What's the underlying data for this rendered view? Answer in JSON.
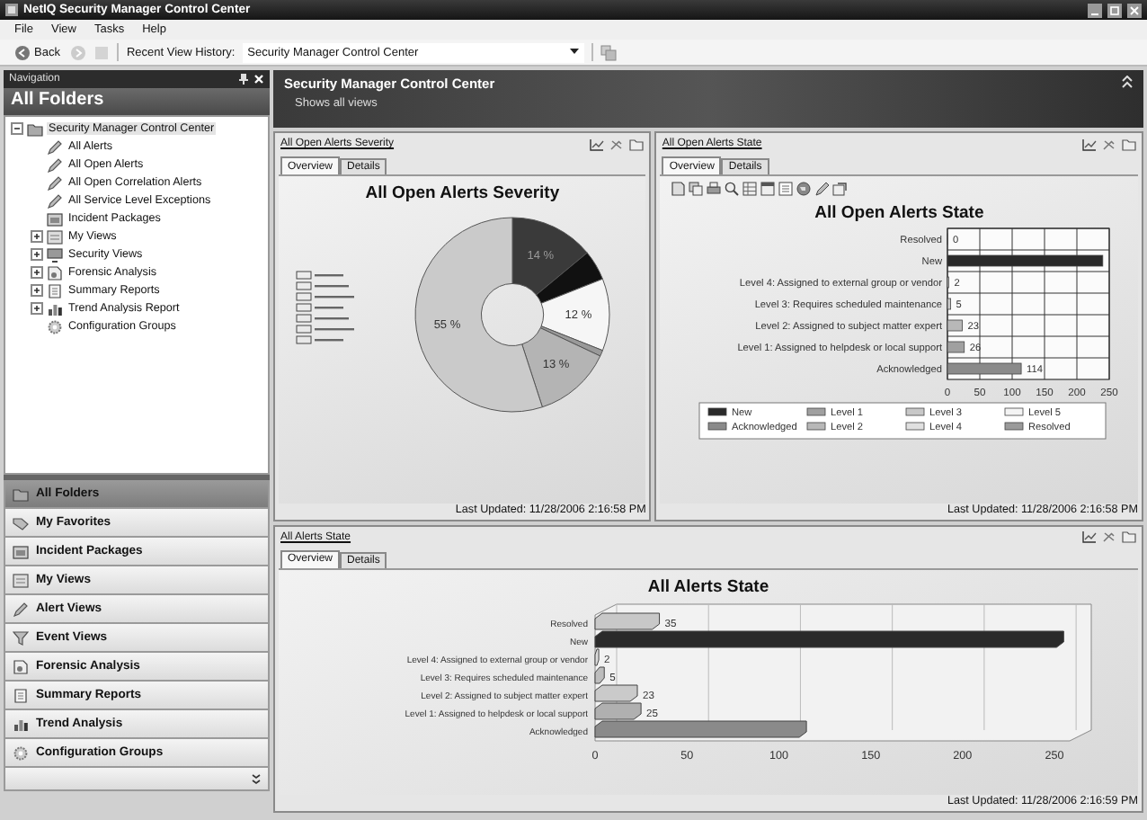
{
  "window": {
    "title": "NetIQ Security Manager Control Center"
  },
  "menu": [
    "File",
    "View",
    "Tasks",
    "Help"
  ],
  "toolbar": {
    "back": "Back",
    "history_label": "Recent View History:",
    "history_value": "Security Manager Control Center"
  },
  "navigation": {
    "title": "Navigation",
    "heading": "All Folders",
    "tree": [
      {
        "label": "Security Manager Control Center",
        "kind": "folder",
        "selected": true,
        "expanded": true,
        "children": [
          {
            "label": "All Alerts",
            "kind": "alert",
            "selected": false
          },
          {
            "label": "All Open Alerts",
            "kind": "alert",
            "selected": false
          },
          {
            "label": "All Open Correlation Alerts",
            "kind": "alert",
            "selected": false
          },
          {
            "label": "All Service Level Exceptions",
            "kind": "alert",
            "selected": false
          },
          {
            "label": "Incident Packages",
            "kind": "package",
            "selected": false
          },
          {
            "label": "My Views",
            "kind": "views",
            "selected": false,
            "expanded": false
          },
          {
            "label": "Security Views",
            "kind": "security",
            "selected": false,
            "expanded": false
          },
          {
            "label": "Forensic Analysis",
            "kind": "forensic",
            "selected": false,
            "expanded": false
          },
          {
            "label": "Summary Reports",
            "kind": "report",
            "selected": false,
            "expanded": false
          },
          {
            "label": "Trend Analysis Report",
            "kind": "trend",
            "selected": false,
            "expanded": false
          },
          {
            "label": "Configuration Groups",
            "kind": "config",
            "selected": false
          }
        ]
      }
    ],
    "buttons": [
      {
        "label": "All Folders",
        "kind": "folder",
        "selected": true
      },
      {
        "label": "My Favorites",
        "kind": "favorites",
        "selected": false
      },
      {
        "label": "Incident Packages",
        "kind": "package",
        "selected": false
      },
      {
        "label": "My Views",
        "kind": "views",
        "selected": false
      },
      {
        "label": "Alert Views",
        "kind": "alert",
        "selected": false
      },
      {
        "label": "Event Views",
        "kind": "event",
        "selected": false
      },
      {
        "label": "Forensic Analysis",
        "kind": "forensic",
        "selected": false
      },
      {
        "label": "Summary Reports",
        "kind": "report",
        "selected": false
      },
      {
        "label": "Trend Analysis",
        "kind": "trend",
        "selected": false
      },
      {
        "label": "Configuration Groups",
        "kind": "config",
        "selected": false
      }
    ]
  },
  "header": {
    "title": "Security Manager Control Center",
    "subtitle": "Shows all views"
  },
  "panels": [
    {
      "link": "All Open Alerts Severity",
      "tabs": [
        {
          "label": "Overview",
          "selected": true
        },
        {
          "label": "Details",
          "selected": false
        }
      ],
      "updated": "Last Updated: 11/28/2006 2:16:58 PM",
      "chart_data": {
        "type": "donut",
        "title": "All Open Alerts Severity",
        "values": [
          14,
          5,
          12,
          1,
          13,
          55
        ],
        "value_labels": [
          "14 %",
          null,
          "12 %",
          null,
          "13 %",
          "55 %"
        ]
      }
    },
    {
      "kind": "flat",
      "link": "All Open Alerts State",
      "tabs": [
        {
          "label": "Overview",
          "selected": true
        },
        {
          "label": "Details",
          "selected": false
        }
      ],
      "updated": "Last Updated: 11/28/2006 2:16:58 PM",
      "chart_data": {
        "type": "bar",
        "orientation": "horizontal",
        "title": "All Open Alerts State",
        "grid": true,
        "legend": "bottom",
        "categories": [
          "Resolved",
          "New",
          "Level 4: Assigned to external group or vendor",
          "Level 3: Requires scheduled maintenance",
          "Level 2: Assigned to subject matter expert",
          "Level 1: Assigned to helpdesk or local support",
          "Acknowledged"
        ],
        "series": [
          {
            "name": "New",
            "color": "#2a2a2a",
            "values": [
              null,
              240,
              null,
              null,
              null,
              null,
              null
            ]
          },
          {
            "name": "Level 1",
            "color": "#a0a0a0",
            "values": [
              null,
              null,
              null,
              null,
              null,
              26,
              null
            ]
          },
          {
            "name": "Level 3",
            "color": "#c8c8c8",
            "values": [
              null,
              null,
              null,
              5,
              null,
              null,
              null
            ]
          },
          {
            "name": "Level 5",
            "color": "#f4f4f4",
            "values": [
              null,
              null,
              null,
              null,
              null,
              null,
              null
            ]
          },
          {
            "name": "Acknowledged",
            "color": "#8a8a8a",
            "values": [
              null,
              null,
              null,
              null,
              null,
              null,
              114
            ]
          },
          {
            "name": "Level 2",
            "color": "#b8b8b8",
            "values": [
              null,
              null,
              null,
              null,
              23,
              null,
              null
            ]
          },
          {
            "name": "Level 4",
            "color": "#e0e0e0",
            "values": [
              null,
              null,
              2,
              null,
              null,
              null,
              null
            ]
          },
          {
            "name": "Resolved",
            "color": "#9a9a9a",
            "values": [
              0,
              null,
              null,
              null,
              null,
              null,
              null
            ]
          }
        ],
        "value_labels": [
          "0",
          null,
          "2",
          "5",
          "23",
          "26",
          "114"
        ],
        "xlim": [
          0,
          250
        ],
        "xticks": [
          0,
          50,
          100,
          150,
          200,
          250
        ]
      }
    },
    {
      "kind": "perspective",
      "link": "All Alerts State",
      "tabs": [
        {
          "label": "Overview",
          "selected": true
        },
        {
          "label": "Details",
          "selected": false
        }
      ],
      "updated": "Last Updated: 11/28/2006 2:16:59 PM",
      "chart_data": {
        "type": "bar",
        "orientation": "horizontal",
        "title": "All Alerts State",
        "grid": true,
        "categories": [
          "Resolved",
          "New",
          "Level 4: Assigned to external group or vendor",
          "Level 3: Requires scheduled maintenance",
          "Level 2: Assigned to subject matter expert",
          "Level 1:  Assigned to helpdesk or local support",
          "Acknowledged"
        ],
        "values": [
          35,
          255,
          2,
          5,
          23,
          25,
          115
        ],
        "value_labels": [
          "35",
          null,
          "2",
          "5",
          "23",
          "25",
          null
        ],
        "xlim": [
          0,
          270
        ],
        "xticks": [
          0,
          50,
          100,
          150,
          200,
          250
        ]
      }
    }
  ]
}
